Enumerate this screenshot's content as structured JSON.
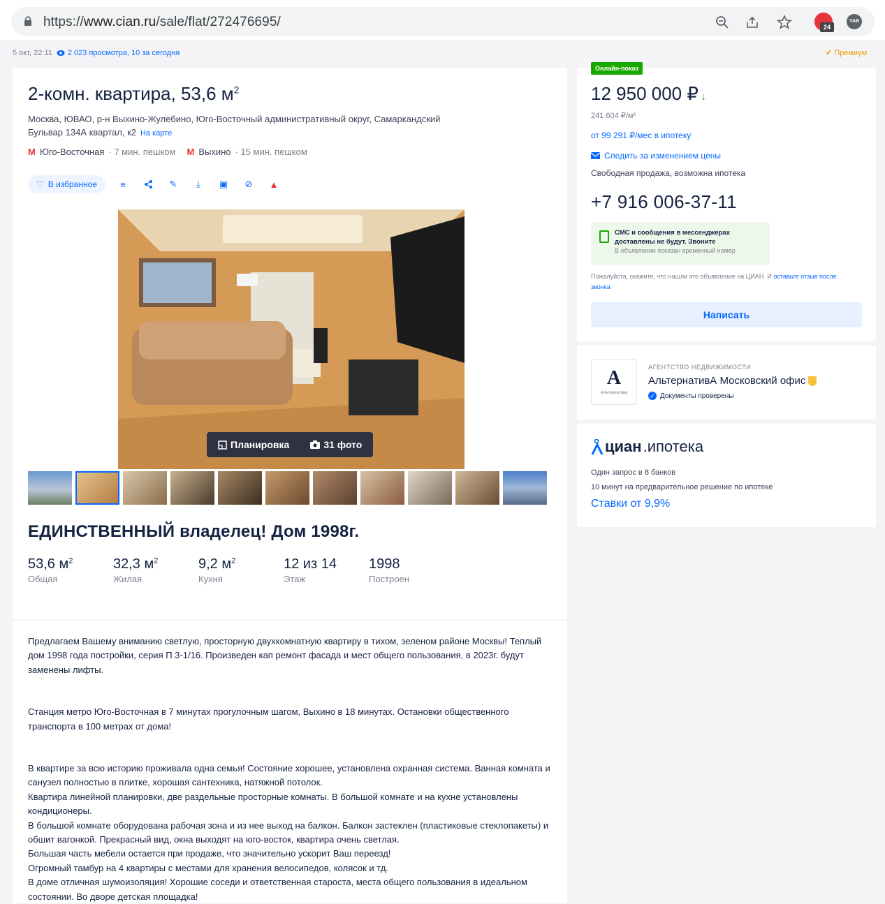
{
  "browser": {
    "url_scheme": "https://",
    "url_host": "www.cian.ru",
    "url_path": "/sale/flat/272476695/"
  },
  "meta": {
    "date": "5 окт, 22:11",
    "views": "2 023 просмотра, 10 за сегодня",
    "premium": "Премиум"
  },
  "listing": {
    "title": "2-комн. квартира, 53,6 м",
    "title_sup": "2",
    "address": "Москва, ЮВАО, р-н Выхино-Жулебино, Юго-Восточный административный округ, Самаркандский Бульвар 134А квартал, к2",
    "map_link": "На карте",
    "metro": [
      {
        "station": "Юго-Восточная",
        "walk": "· 7 мин. пешком"
      },
      {
        "station": "Выхино",
        "walk": "· 15 мин. пешком"
      }
    ],
    "fav_label": "В избранное",
    "photo_buttons": {
      "plan": "Планировка",
      "photos": "31 фото"
    },
    "headline": "ЕДИНСТВЕННЫЙ владелец! Дом 1998г.",
    "specs": [
      {
        "value": "53,6 м",
        "sup": "2",
        "label": "Общая"
      },
      {
        "value": "32,3 м",
        "sup": "2",
        "label": "Жилая"
      },
      {
        "value": "9,2 м",
        "sup": "2",
        "label": "Кухня"
      },
      {
        "value": "12 из 14",
        "sup": "",
        "label": "Этаж"
      },
      {
        "value": "1998",
        "sup": "",
        "label": "Построен"
      }
    ],
    "description": [
      "Предлагаем Вашему вниманию светлую, просторную двухкомнатную квартиру в тихом, зеленом районе Москвы!  Теплый дом 1998 года постройки, серия  П 3-1/16.  Произведен кап ремонт фасада и мест общего пользования, в 2023г. будут заменены лифты.",
      "Станция метро Юго-Восточная в 7 минутах прогулочным шагом, Выхино в 18 минутах. Остановки общественного транспорта в 100 метрах от дома!",
      "В квартире за всю историю проживала одна семья! Состояние хорошее, установлена охранная система. Ванная комната и санузел полностью в плитке, хорошая сантехника, натяжной потолок.",
      "Квартира линейной планировки, две раздельные просторные комнаты. В большой комнате и на кухне установлены кондиционеры.",
      "В большой комнате оборудована рабочая зона и из нее выход на балкон. Балкон застеклен (пластиковые стеклопакеты)  и обшит вагонкой.  Прекрасный вид, окна выходят на юго-восток, квартира очень светлая.",
      "Большая часть мебели остается при продаже, что значительно ускорит Ваш переезд!",
      "Огромный тамбур на 4 квартиры с местами для хранения велосипедов, колясок и тд.",
      "В доме отличная шумоизоляция! Хорошие соседи и ответственная староста, места общего пользования в идеальном состоянии. Во дворе детская площадка!"
    ]
  },
  "sidebar": {
    "online_badge": "Онлайн-показ",
    "price": "12 950 000 ₽",
    "price_per_m2": "241 604 ₽/м²",
    "mortgage": "от 99 291 ₽/мес в ипотеку",
    "watch_price": "Следить за изменением цены",
    "sale_type": "Свободная продажа, возможна ипотека",
    "phone": "+7 916 006-37-11",
    "sms_title": "СМС и сообщения в мессенджерах доставлены не будут. Звоните",
    "sms_sub": "В объявлении показан временный номер",
    "notice_text": "Пожалуйста, скажите, что нашли это объявление на ЦИАН. И ",
    "notice_link": "оставьте отзыв после звонка",
    "write_button": "Написать"
  },
  "agency": {
    "type": "АГЕНТСТВО НЕДВИЖИМОСТИ",
    "name": "АльтернативА Московский офис",
    "verified": "Документы проверены",
    "logo_letter": "А",
    "logo_caption": "Альтернатива"
  },
  "ipoteka": {
    "logo_cian": "циан",
    "logo_ipoteka": ".ипотека",
    "line1": "Один запрос в 8 банков",
    "line2": "10 минут на предварительное решение по ипотеке",
    "rate": "Ставки от 9,9%"
  },
  "colors": {
    "accent": "#0468ff",
    "green": "#18a800",
    "red": "#e8323c",
    "text": "#152242"
  }
}
